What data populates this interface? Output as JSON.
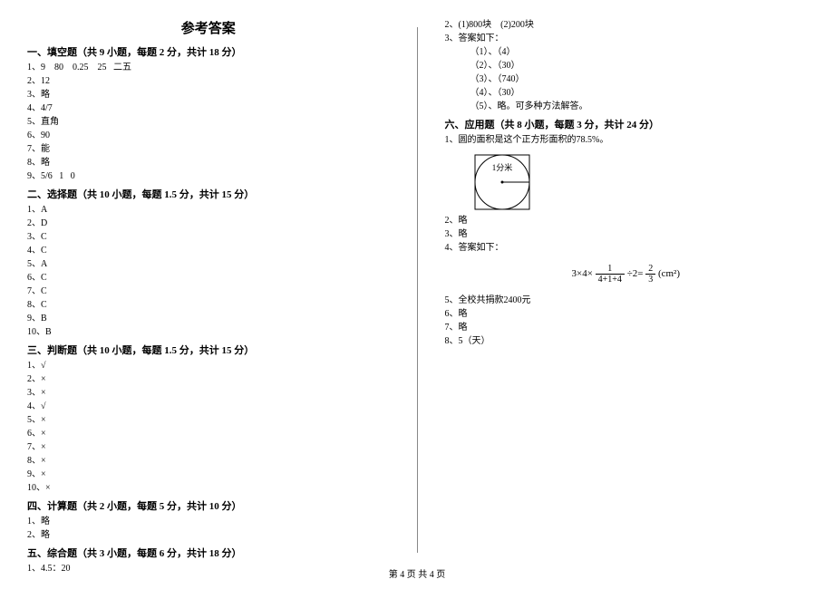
{
  "title": "参考答案",
  "footer": "第 4 页  共 4 页",
  "leftCol": {
    "s1": {
      "head": "一、填空题（共 9 小题，每题 2 分，共计 18 分）",
      "items": [
        "1、9    80    0.25    25   二五",
        "2、12",
        "3、略",
        "4、4/7",
        "5、直角",
        "6、90",
        "7、能",
        "8、略",
        "9、5/6   1   0"
      ]
    },
    "s2": {
      "head": "二、选择题（共 10 小题，每题 1.5 分，共计 15 分）",
      "items": [
        "1、A",
        "2、D",
        "3、C",
        "4、C",
        "5、A",
        "6、C",
        "7、C",
        "8、C",
        "9、B",
        "10、B"
      ]
    },
    "s3": {
      "head": "三、判断题（共 10 小题，每题 1.5 分，共计 15 分）",
      "items": [
        "1、√",
        "2、×",
        "3、×",
        "4、√",
        "5、×",
        "6、×",
        "7、×",
        "8、×",
        "9、×",
        "10、×"
      ]
    },
    "s4": {
      "head": "四、计算题（共 2 小题，每题 5 分，共计 10 分）",
      "items": [
        "1、略",
        "2、略"
      ]
    },
    "s5": {
      "head": "五、综合题（共 3 小题，每题 6 分，共计 18 分）",
      "items": [
        "1、4.5：20"
      ]
    }
  },
  "rightCol": {
    "top": [
      "2、(1)800块    (2)200块",
      "3、答案如下："
    ],
    "topIndent": [
      "（1）、（4）",
      "（2）、（30）",
      "（3）、（740）",
      "（4）、（30）",
      "（5）、略。可多种方法解答。"
    ],
    "s6": {
      "head": "六、应用题（共 8 小题，每题 3 分，共计 24 分）",
      "line1": "1、圆的面积是这个正方形面积的78.5%。",
      "diagramLabel": "1分米",
      "after1": [
        "2、略",
        "3、略",
        "4、答案如下："
      ],
      "formula": {
        "prefix": "3×4×",
        "frac1_num": "1",
        "frac1_den": "4+1+4",
        "mid": "÷2=",
        "frac2_num": "2",
        "frac2_den": "3",
        "suffix": "(cm²)"
      },
      "after2": [
        "5、全校共捐款2400元",
        "6、略",
        "7、略",
        "8、5（天）"
      ]
    }
  }
}
